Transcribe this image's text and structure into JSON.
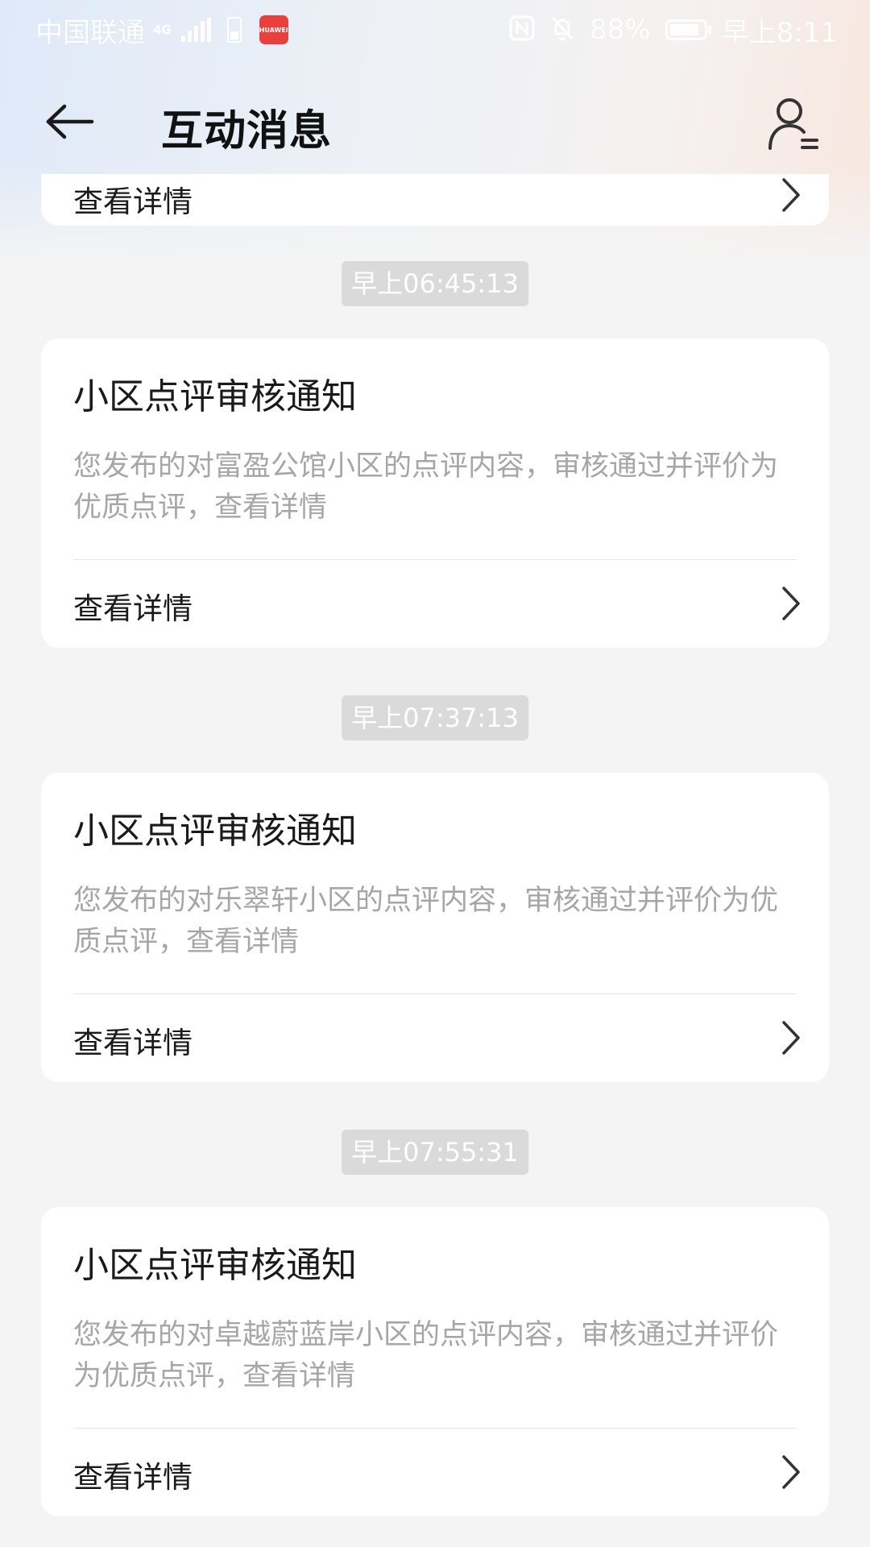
{
  "status_bar": {
    "carrier": "中国联通",
    "network_type": "4G",
    "app_badge": "HUAWEI",
    "battery_level": "88%",
    "battery_fraction": 0.88,
    "time": "早上8:11"
  },
  "header": {
    "title": "互动消息"
  },
  "partial_card": {
    "link_label": "查看详情"
  },
  "messages": [
    {
      "time": "早上06:45:13",
      "title": "小区点评审核通知",
      "description": "您发布的对富盈公馆小区的点评内容，审核通过并评价为优质点评，查看详情",
      "link_label": "查看详情"
    },
    {
      "time": "早上07:37:13",
      "title": "小区点评审核通知",
      "description": "您发布的对乐翠轩小区的点评内容，审核通过并评价为优质点评，查看详情",
      "link_label": "查看详情"
    },
    {
      "time": "早上07:55:31",
      "title": "小区点评审核通知",
      "description": "您发布的对卓越蔚蓝岸小区的点评内容，审核通过并评价为优质点评，查看详情",
      "link_label": "查看详情"
    }
  ],
  "icons": {
    "back": "arrow-left-icon",
    "profile": "user-list-icon",
    "chevron": "chevron-right-icon",
    "nfc": "nfc-icon",
    "mute": "bell-off-icon",
    "battery": "battery-icon",
    "signal": "signal-icon"
  },
  "colors": {
    "background": "#f4f4f4",
    "card": "#ffffff",
    "title_text": "#1a1a1a",
    "description_text": "#a6a6a6",
    "time_badge": "#dadada"
  }
}
